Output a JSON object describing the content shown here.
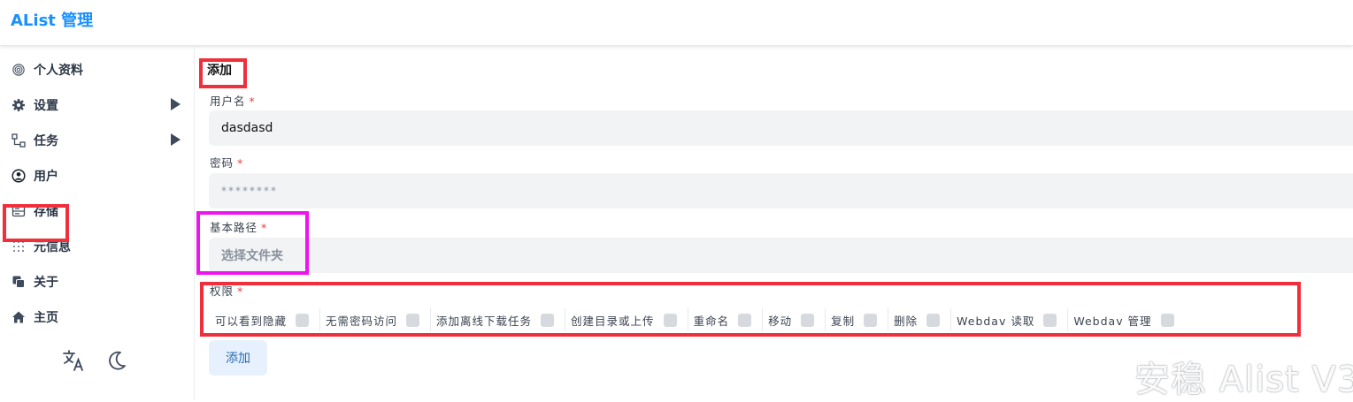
{
  "header": {
    "brand": "AList 管理"
  },
  "sidebar": {
    "items": [
      {
        "label": "个人资料",
        "icon": "fingerprint-icon",
        "has_submenu": false
      },
      {
        "label": "设置",
        "icon": "gear-icon",
        "has_submenu": true
      },
      {
        "label": "任务",
        "icon": "flowchart-icon",
        "has_submenu": true
      },
      {
        "label": "用户",
        "icon": "user-circle-icon",
        "has_submenu": false
      },
      {
        "label": "存储",
        "icon": "storage-icon",
        "has_submenu": false
      },
      {
        "label": "元信息",
        "icon": "metadata-icon",
        "has_submenu": false
      },
      {
        "label": "关于",
        "icon": "copy-icon",
        "has_submenu": false
      },
      {
        "label": "主页",
        "icon": "home-icon",
        "has_submenu": false
      }
    ],
    "tools": [
      {
        "icon": "translate-icon"
      },
      {
        "icon": "moon-icon"
      }
    ]
  },
  "form": {
    "title": "添加",
    "username": {
      "label": "用户名",
      "required_mark": "*",
      "value": "dasdasd"
    },
    "password": {
      "label": "密码",
      "required_mark": "*",
      "value": "********"
    },
    "base_path": {
      "label": "基本路径",
      "required_mark": "*",
      "placeholder": "选择文件夹"
    },
    "permissions": {
      "label": "权限",
      "required_mark": "*",
      "items": [
        {
          "label": "可以看到隐藏",
          "checked": false
        },
        {
          "label": "无需密码访问",
          "checked": false
        },
        {
          "label": "添加离线下载任务",
          "checked": false
        },
        {
          "label": "创建目录或上传",
          "checked": false
        },
        {
          "label": "重命名",
          "checked": false
        },
        {
          "label": "移动",
          "checked": false
        },
        {
          "label": "复制",
          "checked": false
        },
        {
          "label": "删除",
          "checked": false
        },
        {
          "label": "Webdav 读取",
          "checked": false
        },
        {
          "label": "Webdav 管理",
          "checked": false
        }
      ]
    },
    "submit_label": "添加"
  },
  "watermark": "安稳 Alist V3",
  "colors": {
    "brand": "#1890ff",
    "highlight_red": "#ef2f3b",
    "highlight_magenta": "#ee14ee",
    "required": "#e53e3e"
  }
}
